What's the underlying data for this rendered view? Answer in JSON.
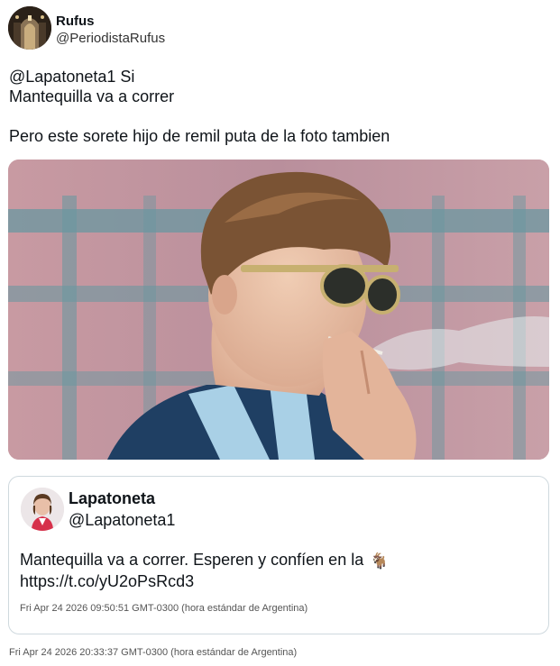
{
  "tweet": {
    "author": {
      "name": "Rufus",
      "handle": "@PeriodistaRufus",
      "avatar_icon": "dark-church-interior-avatar"
    },
    "text": "@Lapatoneta1 Si\nMantequilla va a correr\n\nPero este sorete hijo de remil puta de la foto tambien",
    "photo": {
      "subject_icon": "man-sunglasses-smoking-photo",
      "palette": [
        "#c9a3a8",
        "#5f8d96",
        "#2e5a7a",
        "#e8c6a8"
      ]
    },
    "timestamp": "Fri Apr 24 2026 20:33:37 GMT-0300 (hora estándar de Argentina)"
  },
  "quoted_tweet": {
    "author": {
      "name": "Lapatoneta",
      "handle": "@Lapatoneta1",
      "avatar_icon": "woman-red-jacket-avatar"
    },
    "text": "Mantequilla va a correr. Esperen y confíen en la",
    "emoji": "🐐",
    "link": "https://t.co/yU2oPsRcd3",
    "timestamp": "Fri Apr 24 2026 09:50:51 GMT-0300 (hora estándar de Argentina)"
  },
  "colors": {
    "text": "#0f1419",
    "muted": "#555555",
    "border": "#cfd9de"
  }
}
